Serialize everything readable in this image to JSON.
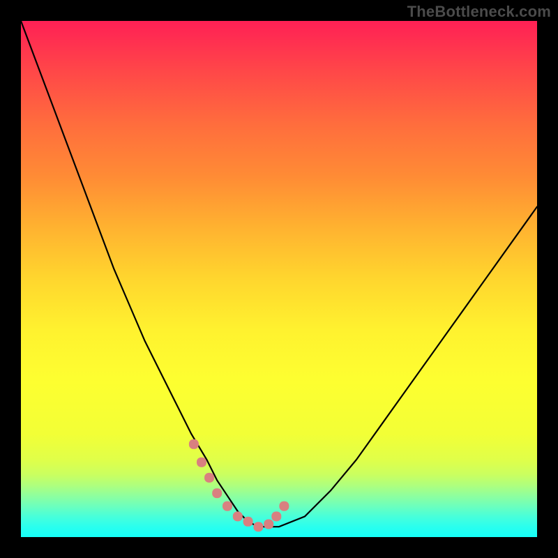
{
  "watermark": "TheBottleneck.com",
  "colors": {
    "background": "#000000",
    "gradient_top": "#ff2055",
    "gradient_bottom": "#16fff9",
    "curve_stroke": "#000000",
    "marker_fill": "#d98080",
    "marker_stroke": "#d97878"
  },
  "chart_data": {
    "type": "line",
    "title": "",
    "xlabel": "",
    "ylabel": "",
    "xlim": [
      0,
      100
    ],
    "ylim": [
      0,
      100
    ],
    "grid": false,
    "legend": false,
    "series": [
      {
        "name": "bottleneck-curve",
        "x": [
          0,
          3,
          6,
          9,
          12,
          15,
          18,
          21,
          24,
          27,
          30,
          33,
          36,
          38,
          40,
          42,
          44,
          46,
          50,
          55,
          60,
          65,
          70,
          75,
          80,
          85,
          90,
          95,
          100
        ],
        "y": [
          100,
          92,
          84,
          76,
          68,
          60,
          52,
          45,
          38,
          32,
          26,
          20,
          15,
          11,
          8,
          5,
          3,
          2,
          2,
          4,
          9,
          15,
          22,
          29,
          36,
          43,
          50,
          57,
          64
        ]
      }
    ],
    "markers": {
      "name": "bottleneck-highlight",
      "x": [
        33.5,
        35,
        36.5,
        38,
        40,
        42,
        44,
        46,
        48,
        49.5,
        51
      ],
      "y": [
        18,
        14.5,
        11.5,
        8.5,
        6,
        4,
        3,
        2,
        2.5,
        4,
        6
      ],
      "size": 14
    }
  }
}
